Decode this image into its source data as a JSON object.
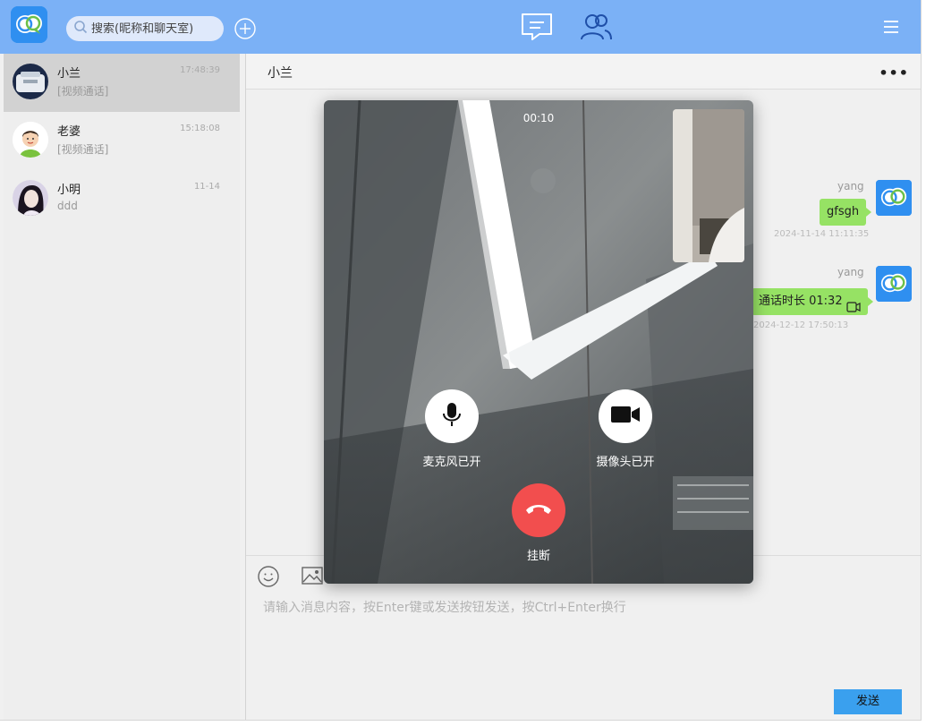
{
  "search": {
    "placeholder": "搜索(昵称和聊天室)"
  },
  "conversations": [
    {
      "name": "小兰",
      "time": "17:48:39",
      "preview": "[视频通话]"
    },
    {
      "name": "老婆",
      "time": "15:18:08",
      "preview": "[视频通话]"
    },
    {
      "name": "小明",
      "time": "11-14",
      "preview": "ddd"
    }
  ],
  "chat": {
    "title": "小兰",
    "more": "•••",
    "messages": [
      {
        "sender": "yang",
        "text": "gfsgh",
        "time": "2024-11-14 11:11:35"
      },
      {
        "sender": "yang",
        "text": "通话时长 01:32",
        "time": "2024-12-12 17:50:13"
      }
    ]
  },
  "input": {
    "placeholder": "请输入消息内容，按Enter键或发送按钮发送，按Ctrl+Enter换行"
  },
  "send_label": "发送",
  "call": {
    "timer": "00:10",
    "mic_label": "麦克风已开",
    "camera_label": "摄像头已开",
    "hangup_label": "挂断"
  },
  "colors": {
    "topbar": "#7bb1f6",
    "bubble": "#96e264",
    "send_button": "#3aa0ee",
    "hangup": "#f24e4e",
    "logo": "#2f8ff0"
  },
  "icons": {
    "logo": "app-logo-icon",
    "search": "search-icon",
    "add": "plus-circle-icon",
    "chat_nav": "chat-bubble-icon",
    "contacts_nav": "contacts-icon",
    "menu": "hamburger-icon",
    "emoji": "emoji-icon",
    "image": "image-icon",
    "mic": "microphone-icon",
    "camera": "video-camera-icon",
    "hangup": "phone-hangup-icon",
    "call_record": "video-call-icon"
  }
}
